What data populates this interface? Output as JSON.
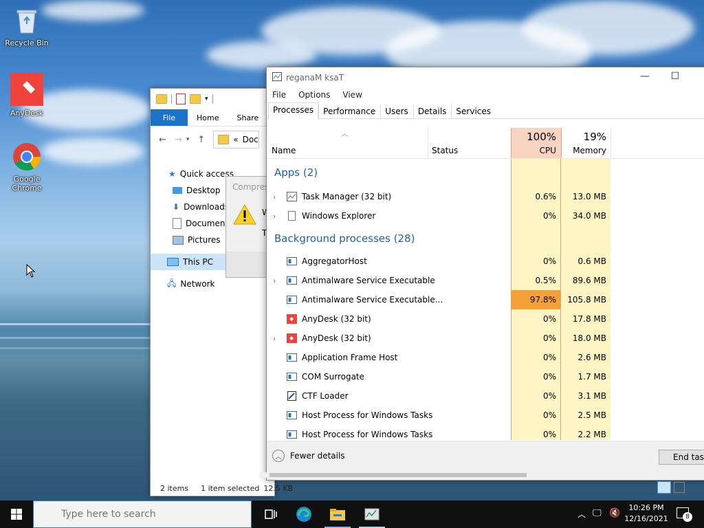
{
  "desktop": {
    "icons": [
      {
        "label": "Recycle Bin"
      },
      {
        "label": "AnyDesk"
      },
      {
        "label": "Google Chrome"
      }
    ]
  },
  "explorer": {
    "tabs": {
      "file": "File",
      "home": "Home",
      "share": "Share"
    },
    "address": "Doc",
    "address_prefix": "«",
    "nav": [
      "Quick access",
      "Desktop",
      "Downloads",
      "Documen",
      "Pictures",
      "This PC",
      "Network"
    ],
    "status": {
      "items": "2 items",
      "selected": "1 item selected",
      "size": "12.5 KB"
    }
  },
  "dialog": {
    "title": "Compres",
    "line1": "W",
    "line2": "T"
  },
  "taskmgr": {
    "title": "reganaM ksaT",
    "menu": [
      "File",
      "Options",
      "View"
    ],
    "tabs": [
      "Processes",
      "Performance",
      "Users",
      "Details",
      "Services"
    ],
    "columns": {
      "name": "Name",
      "status": "Status",
      "cpu_pct": "100%",
      "cpu": "CPU",
      "mem_pct": "19%",
      "mem": "Memory"
    },
    "groups": {
      "apps": "Apps (2)",
      "bg": "Background processes (28)"
    },
    "apps": [
      {
        "name": "Task Manager (32 bit)",
        "cpu": "0.6%",
        "mem": "13.0 MB"
      },
      {
        "name": "Windows Explorer",
        "cpu": "0%",
        "mem": "34.0 MB"
      }
    ],
    "bg": [
      {
        "name": "AggregatorHost",
        "cpu": "0%",
        "mem": "0.6 MB"
      },
      {
        "name": "Antimalware Service Executable",
        "cpu": "0.5%",
        "mem": "89.6 MB"
      },
      {
        "name": "Antimalware Service Executable...",
        "cpu": "97.8%",
        "mem": "105.8 MB"
      },
      {
        "name": "AnyDesk (32 bit)",
        "cpu": "0%",
        "mem": "17.8 MB"
      },
      {
        "name": "AnyDesk (32 bit)",
        "cpu": "0%",
        "mem": "18.0 MB"
      },
      {
        "name": "Application Frame Host",
        "cpu": "0%",
        "mem": "2.6 MB"
      },
      {
        "name": "COM Surrogate",
        "cpu": "0%",
        "mem": "1.7 MB"
      },
      {
        "name": "CTF Loader",
        "cpu": "0%",
        "mem": "3.1 MB"
      },
      {
        "name": "Host Process for Windows Tasks",
        "cpu": "0%",
        "mem": "2.5 MB"
      },
      {
        "name": "Host Process for Windows Tasks",
        "cpu": "0%",
        "mem": "2.2 MB"
      }
    ],
    "fewer_details": "Fewer details",
    "end_task": "End task"
  },
  "taskbar": {
    "search_placeholder": "Type here to search",
    "time": "10:26 PM",
    "date": "12/16/2021",
    "notifications": "8"
  },
  "colors": {
    "accent": "#1a73c8",
    "cpu_hot": "#f5a13a",
    "heat": "#fff4c4",
    "group_text": "#1f5fa8"
  }
}
